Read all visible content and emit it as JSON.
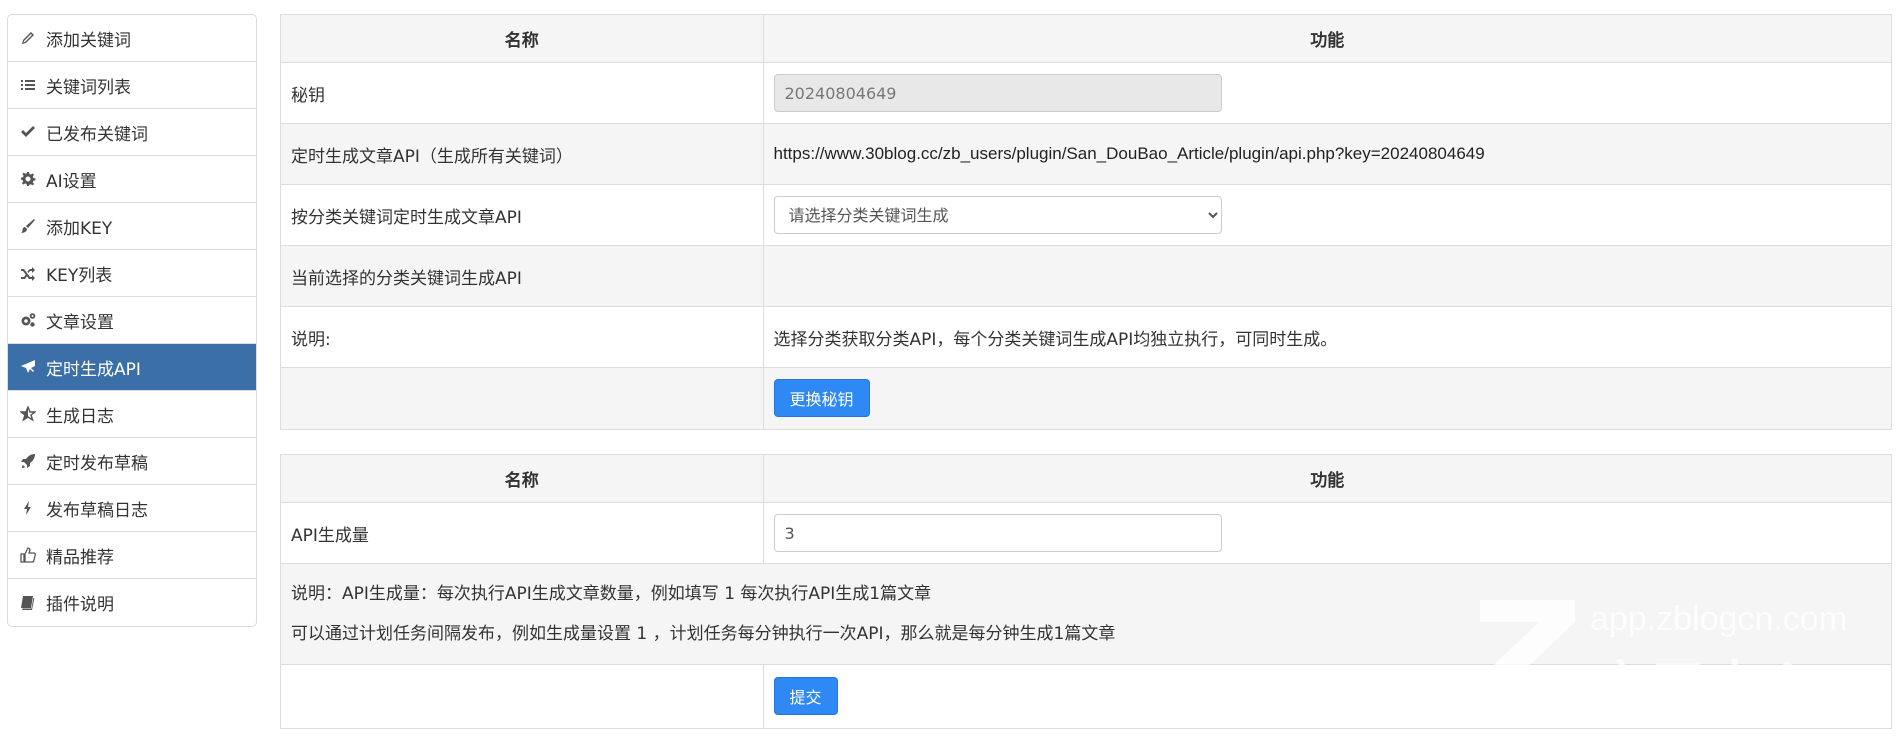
{
  "sidebar": {
    "items": [
      {
        "label": "添加关键词",
        "icon": "pencil-icon",
        "active": false
      },
      {
        "label": "关键词列表",
        "icon": "list-icon",
        "active": false
      },
      {
        "label": "已发布关键词",
        "icon": "check-icon",
        "active": false
      },
      {
        "label": "AI设置",
        "icon": "gear-icon",
        "active": false
      },
      {
        "label": "添加KEY",
        "icon": "brush-icon",
        "active": false
      },
      {
        "label": "KEY列表",
        "icon": "shuffle-icon",
        "active": false
      },
      {
        "label": "文章设置",
        "icon": "gears-icon",
        "active": false
      },
      {
        "label": "定时生成API",
        "icon": "plane-icon",
        "active": true
      },
      {
        "label": "生成日志",
        "icon": "star-half-icon",
        "active": false
      },
      {
        "label": "定时发布草稿",
        "icon": "rocket-icon",
        "active": false
      },
      {
        "label": "发布草稿日志",
        "icon": "bolt-icon",
        "active": false
      },
      {
        "label": "精品推荐",
        "icon": "thumbs-up-icon",
        "active": false
      },
      {
        "label": "插件说明",
        "icon": "book-icon",
        "active": false
      }
    ],
    "active_color": "#3a6fa8"
  },
  "api_table": {
    "header_name": "名称",
    "header_func": "功能",
    "secret_label": "秘钥",
    "secret_value": "20240804649",
    "all_api_label": "定时生成文章API（生成所有关键词）",
    "all_api_url": "https://www.30blog.cc/zb_users/plugin/San_DouBao_Article/plugin/api.php?key=20240804649",
    "category_api_label": "按分类关键词定时生成文章API",
    "category_select_value": "请选择分类关键词生成",
    "current_api_label": "当前选择的分类关键词生成API",
    "current_api_value": "",
    "note_label": "说明:",
    "note_text": "选择分类获取分类API，每个分类关键词生成API均独立执行，可同时生成。",
    "change_key_button": "更换秘钥"
  },
  "amount_table": {
    "header_name": "名称",
    "header_func": "功能",
    "amount_label": "API生成量",
    "amount_value": "3",
    "note_line1": "说明：API生成量：每次执行API生成文章数量，例如填写 1 每次执行API生成1篇文章",
    "note_line2": "可以通过计划任务间隔发布，例如生成量设置 1 ，计划任务每分钟执行一次API，那么就是每分钟生成1篇文章",
    "submit_button": "提交"
  },
  "watermark": {
    "domain": "app.zblogcn.com",
    "text": "应用中心"
  },
  "colors": {
    "button": "#2f89f5",
    "row_alt": "#f5f5f5",
    "border": "#dcdcdc"
  }
}
